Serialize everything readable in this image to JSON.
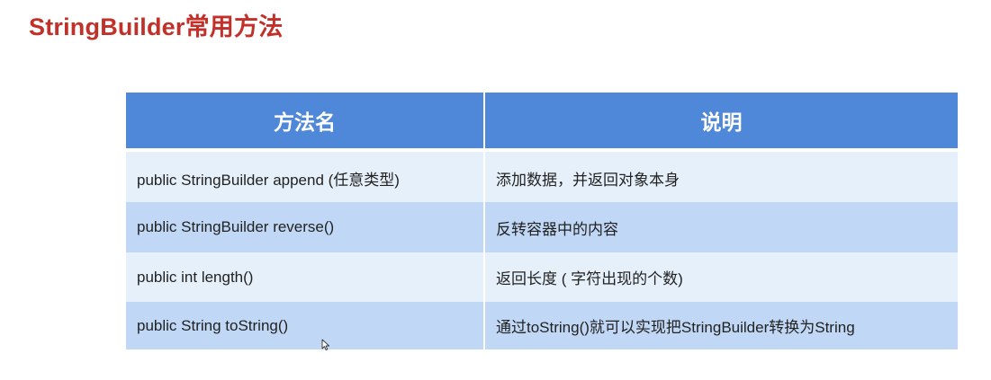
{
  "slide": {
    "title": "StringBuilder常用方法"
  },
  "table": {
    "headers": [
      "方法名",
      "说明"
    ],
    "rows": [
      {
        "method": "public StringBuilder append (任意类型)",
        "description": "添加数据，并返回对象本身"
      },
      {
        "method": "public StringBuilder reverse()",
        "description": "反转容器中的内容"
      },
      {
        "method": "public int length()",
        "description": "返回长度 ( 字符出现的个数)"
      },
      {
        "method": "public String toString()",
        "description": "通过toString()就可以实现把StringBuilder转换为String"
      }
    ]
  },
  "colors": {
    "title": "#c2302a",
    "header_bg": "#4f88d8",
    "row_light": "#e6f0fb",
    "row_dark": "#c0d8f5"
  },
  "cursor": {
    "icon": "mouse-pointer-icon"
  }
}
